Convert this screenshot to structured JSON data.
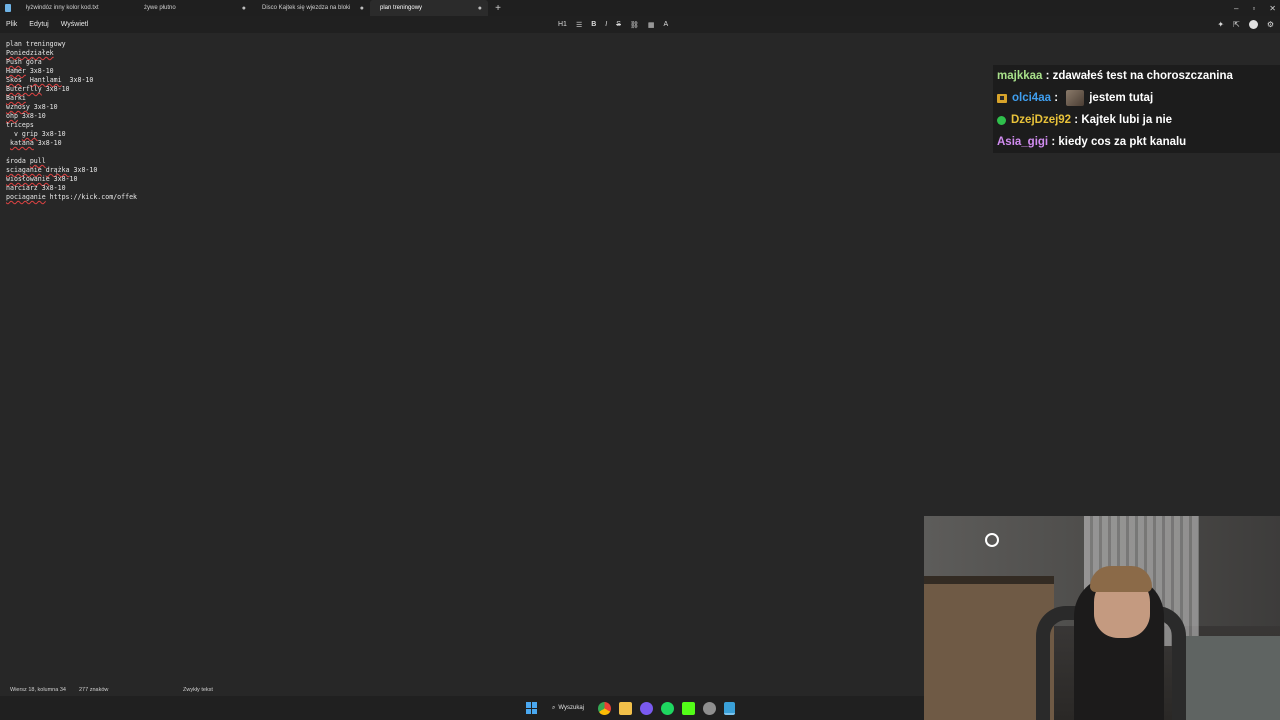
{
  "tabs": [
    {
      "label": "łyżwindóz inny kolor kod.txt",
      "active": false
    },
    {
      "label": "żywe płutno",
      "active": false,
      "modified": true
    },
    {
      "label": "Disco Kajtek się wjezdza na bloki",
      "active": false,
      "modified": true
    },
    {
      "label": "plan treningowy",
      "active": true,
      "modified": true
    }
  ],
  "tab_marker": "●",
  "new_tab": "+",
  "window_controls": {
    "minimize": "–",
    "restore": "▫",
    "close": "✕"
  },
  "menu": {
    "file": "Plik",
    "edit": "Edytuj",
    "view": "Wyświetl"
  },
  "format_toolbar": {
    "heading": "H1",
    "list": "☰",
    "bold": "B",
    "italic": "I",
    "strikethrough": "S",
    "link": "⛓",
    "table": "▦",
    "clear": "A"
  },
  "editor_lines": [
    "plan treningowy",
    "Poniedziałek",
    "Push góra",
    "Hamer 3x8-10",
    "Skos  Hantlami  3x8-10",
    "Buterflly 3x8-10",
    "Barki",
    "wznosy 3x8-10",
    "ohp 3x8-10",
    "triceps",
    "  v grip 3x8-10",
    " katana 3x8-10",
    "",
    "środa pull",
    "sciaganie drążka 3x8-10",
    "wiosłowanie 3x8-10",
    "narciarz 3x8-10",
    "pociaganie https://kick.com/offek"
  ],
  "chat": [
    {
      "user": "majkkaa",
      "user_color": "#a8e08a",
      "badge": null,
      "emote": false,
      "text": "zdawałeś test na choroszczanina"
    },
    {
      "user": "olci4aa",
      "user_color": "#3f9ff0",
      "badge": "star",
      "emote": true,
      "text": "jestem tutaj"
    },
    {
      "user": "DzejDzej92",
      "user_color": "#e8c23a",
      "badge": "check",
      "emote": false,
      "text": "Kajtek lubi ja nie"
    },
    {
      "user": "Asia_gigi",
      "user_color": "#d18cf0",
      "badge": null,
      "emote": false,
      "text": "kiedy cos za pkt kanalu"
    }
  ],
  "status": {
    "position": "Wiersz 18, kolumna 34",
    "chars": "277 znaków",
    "mode": "Zwykły tekst"
  },
  "taskbar": {
    "search": "Wyszukaj"
  }
}
